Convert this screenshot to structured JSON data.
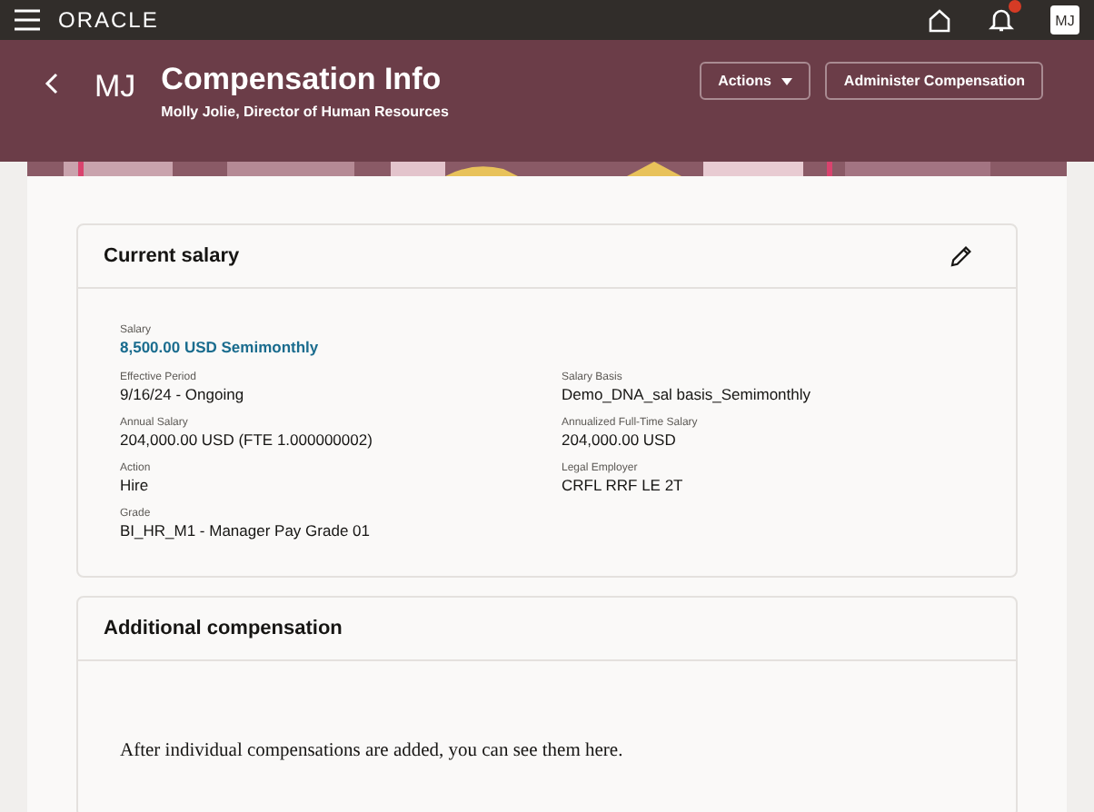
{
  "top_bar": {
    "logo": "ORACLE",
    "avatar": "MJ"
  },
  "header": {
    "initials": "MJ",
    "title": "Compensation Info",
    "subtitle": "Molly Jolie, Director of Human Resources",
    "buttons": [
      {
        "label": "Actions",
        "kind": "menu"
      },
      {
        "label": "Administer Compensation",
        "kind": "plain"
      }
    ]
  },
  "current_salary": {
    "title": "Current salary",
    "salary": {
      "label": "Salary",
      "value": "8,500.00 USD Semimonthly"
    },
    "fields": [
      {
        "label": "Effective Period",
        "value": "9/16/24 - Ongoing"
      },
      {
        "label": "Salary Basis",
        "value": "Demo_DNA_sal basis_Semimonthly"
      },
      {
        "label": "Annual Salary",
        "value": "204,000.00 USD (FTE 1.000000002)"
      },
      {
        "label": "Annualized Full-Time Salary",
        "value": "204,000.00 USD"
      },
      {
        "label": "Action",
        "value": "Hire"
      },
      {
        "label": "Legal Employer",
        "value": "CRFL RRF LE 2T"
      },
      {
        "label": "Grade",
        "value": "BI_HR_M1 - Manager Pay Grade 01"
      }
    ]
  },
  "additional_compensation": {
    "title": "Additional compensation",
    "message": "After individual compensations are added, you can see them here."
  }
}
